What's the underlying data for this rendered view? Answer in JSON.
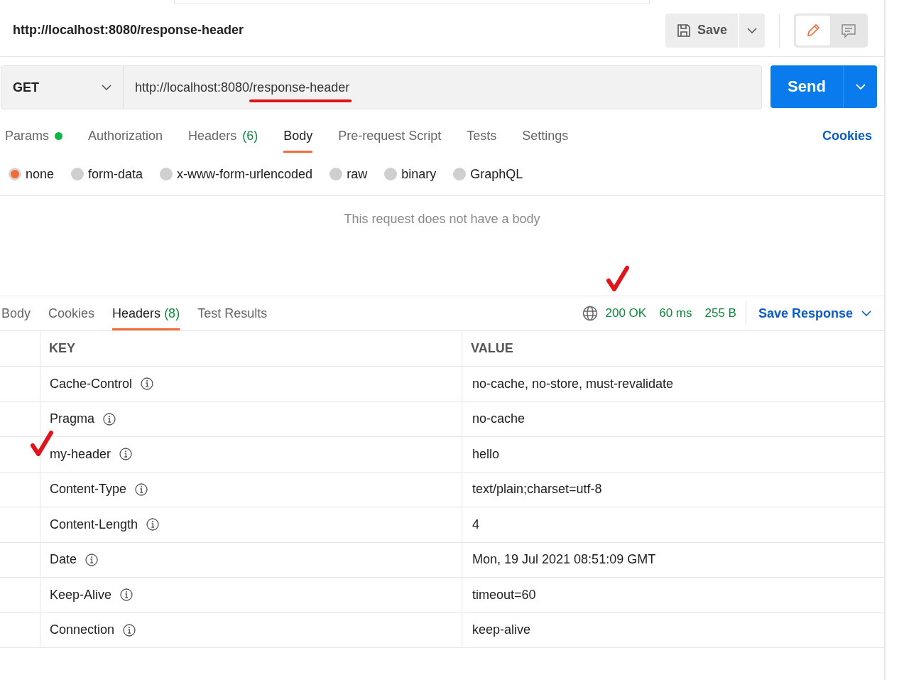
{
  "request": {
    "title": "http://localhost:8080/response-header",
    "save_label": "Save",
    "mode_toggle": [
      {
        "kind": "edit",
        "selected": true
      },
      {
        "kind": "comment",
        "selected": false
      }
    ]
  },
  "url_bar": {
    "method": "GET",
    "url_base": "http://localhost:8080/",
    "url_path": "response-header",
    "path_marked": true,
    "send_label": "Send"
  },
  "request_tabs": [
    {
      "label": "Params",
      "dot": true,
      "selected": false
    },
    {
      "label": "Authorization",
      "dot": false,
      "selected": false
    },
    {
      "label": "Headers",
      "count": "(6)",
      "dot": false,
      "selected": false
    },
    {
      "label": "Body",
      "dot": false,
      "selected": true
    },
    {
      "label": "Pre-request Script",
      "dot": false,
      "selected": false
    },
    {
      "label": "Tests",
      "dot": false,
      "selected": false
    },
    {
      "label": "Settings",
      "dot": false,
      "selected": false
    }
  ],
  "cookies_link": "Cookies",
  "body_types": [
    {
      "label": "none",
      "selected": true
    },
    {
      "label": "form-data",
      "selected": false
    },
    {
      "label": "x-www-form-urlencoded",
      "selected": false
    },
    {
      "label": "raw",
      "selected": false
    },
    {
      "label": "binary",
      "selected": false
    },
    {
      "label": "GraphQL",
      "selected": false
    }
  ],
  "body_message": "This request does not have a body",
  "response_tabs": [
    {
      "label": "Body",
      "selected": false
    },
    {
      "label": "Cookies",
      "selected": false
    },
    {
      "label": "Headers",
      "count": "(8)",
      "selected": true
    },
    {
      "label": "Test Results",
      "selected": false
    }
  ],
  "response_meta": {
    "status": "200 OK",
    "status_marked": true,
    "time": "60 ms",
    "size": "255 B",
    "save_response": "Save Response"
  },
  "table": {
    "columns": [
      "KEY",
      "VALUE"
    ],
    "rows": [
      {
        "key": "Cache-Control",
        "value": "no-cache, no-store, must-revalidate",
        "marked": false
      },
      {
        "key": "Pragma",
        "value": "no-cache",
        "marked": false
      },
      {
        "key": "my-header",
        "value": "hello",
        "marked": true
      },
      {
        "key": "Content-Type",
        "value": "text/plain;charset=utf-8",
        "marked": false
      },
      {
        "key": "Content-Length",
        "value": "4",
        "marked": false
      },
      {
        "key": "Date",
        "value": "Mon, 19 Jul 2021 08:51:09 GMT",
        "marked": false
      },
      {
        "key": "Keep-Alive",
        "value": "timeout=60",
        "marked": false
      },
      {
        "key": "Connection",
        "value": "keep-alive",
        "marked": false
      }
    ]
  }
}
